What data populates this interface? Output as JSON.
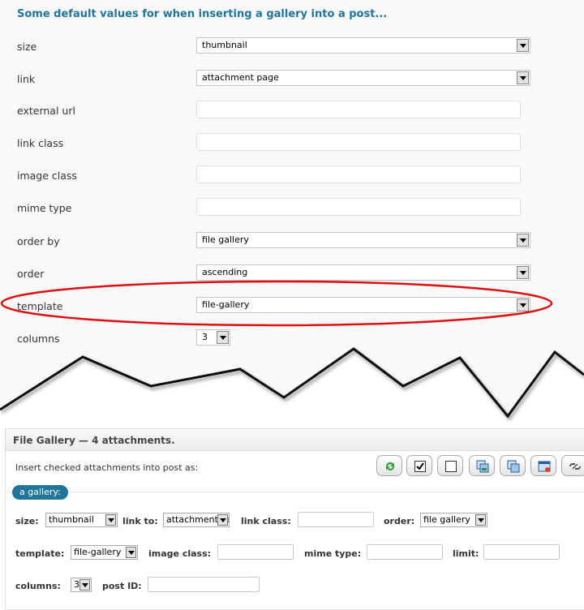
{
  "settings": {
    "heading": "Some default values for when inserting a gallery into a post...",
    "rows": [
      {
        "label": "size",
        "kind": "select",
        "value": "thumbnail"
      },
      {
        "label": "link",
        "kind": "select",
        "value": "attachment page"
      },
      {
        "label": "external url",
        "kind": "text",
        "value": ""
      },
      {
        "label": "link class",
        "kind": "text",
        "value": ""
      },
      {
        "label": "image class",
        "kind": "text",
        "value": ""
      },
      {
        "label": "mime type",
        "kind": "text",
        "value": ""
      },
      {
        "label": "order by",
        "kind": "select",
        "value": "file gallery"
      },
      {
        "label": "order",
        "kind": "select",
        "value": "ascending"
      },
      {
        "label": "template",
        "kind": "select",
        "value": "file-gallery"
      },
      {
        "label": "columns",
        "kind": "select",
        "value": "3"
      }
    ]
  },
  "panel": {
    "title": "File Gallery — 4 attachments.",
    "insert_label": "Insert checked attachments into post as:",
    "toolbar_icons": [
      "refresh-icon",
      "check-all-icon",
      "uncheck-all-icon",
      "copy-icon",
      "duplicate-icon",
      "delete-icon",
      "unlink-icon"
    ],
    "tab": "a gallery:",
    "fields": {
      "size_label": "size:",
      "size_value": "thumbnail",
      "linkto_label": "link to:",
      "linkto_value": "attachment page",
      "linkclass_label": "link class:",
      "order_label": "order:",
      "order_value": "file gallery",
      "template_label": "template:",
      "template_value": "file-gallery",
      "imageclass_label": "image class:",
      "mimetype_label": "mime type:",
      "limit_label": "limit:",
      "columns_label": "columns:",
      "columns_value": "3",
      "postid_label": "post ID:"
    }
  },
  "highlight_color": "#e01010",
  "accent_color": "#21759b"
}
